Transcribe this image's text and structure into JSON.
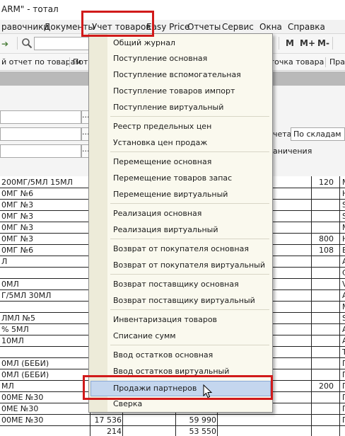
{
  "window": {
    "title": "ARM\" - тотал"
  },
  "menubar": {
    "items": [
      {
        "label": "равочники"
      },
      {
        "label": "Документы"
      },
      {
        "label": "Учет товаров"
      },
      {
        "label": "Easy Price"
      },
      {
        "label": "Отчеты"
      },
      {
        "label": "Сервис"
      },
      {
        "label": "Окна"
      },
      {
        "label": "Справка"
      }
    ]
  },
  "toolbar": {
    "m": "M",
    "m_plus": "M+",
    "m_minus": "M-"
  },
  "links": {
    "items": [
      {
        "label": "й отчет по товарам"
      },
      {
        "label": "Потр"
      },
      {
        "label": "оточка товара"
      },
      {
        "label": "Пра"
      }
    ]
  },
  "form": {
    "dots": "...",
    "report_label": "чета:",
    "report_value": "По складам",
    "restrict_label": "аничения"
  },
  "dropdown": {
    "items": [
      {
        "label": "Общий журнал"
      },
      {
        "label": "Поступление основная"
      },
      {
        "label": "Поступление вспомогательная"
      },
      {
        "label": "Поступление товаров импорт"
      },
      {
        "label": "Поступление виртуальный"
      },
      {
        "label": "Реестр предельных цен"
      },
      {
        "label": "Установка цен продаж"
      },
      {
        "label": "Перемещение основная"
      },
      {
        "label": "Перемещение товаров запас"
      },
      {
        "label": "Перемещение виртуальный"
      },
      {
        "label": "Реализация основная"
      },
      {
        "label": "Реализация виртуальный"
      },
      {
        "label": "Возврат от покупателя основная"
      },
      {
        "label": "Возврат от покупателя виртуальный"
      },
      {
        "label": "Возврат поставщику основная"
      },
      {
        "label": "Возврат поставщику виртуальный"
      },
      {
        "label": "Инвентаризация товаров"
      },
      {
        "label": "Списание сумм"
      },
      {
        "label": "Ввод остатков основная"
      },
      {
        "label": "Ввод остатков виртуальный"
      },
      {
        "label": "Продажи партнеров"
      },
      {
        "label": "Сверка"
      }
    ],
    "highlighted": "Продажи партнеров"
  },
  "grid": {
    "rows": [
      {
        "name": "200МГ/5МЛ 15МЛ",
        "c1": "",
        "c2": "",
        "qty": "120",
        "tail": "М"
      },
      {
        "name": "0МГ №6",
        "c1": "",
        "c2": "",
        "qty": "",
        "tail": "Н"
      },
      {
        "name": "0МГ №3",
        "c1": "",
        "c2": "",
        "qty": "",
        "tail": "S"
      },
      {
        "name": "0МГ №3",
        "c1": "",
        "c2": "",
        "qty": "",
        "tail": "S"
      },
      {
        "name": "0МГ №3",
        "c1": "",
        "c2": "",
        "qty": "",
        "tail": "М"
      },
      {
        "name": "0МГ №3",
        "c1": "",
        "c2": "",
        "qty": "800",
        "tail": "Н"
      },
      {
        "name": "0МГ №6",
        "c1": "",
        "c2": "",
        "qty": "108",
        "tail": "Е"
      },
      {
        "name": "Л",
        "c1": "",
        "c2": "",
        "qty": "",
        "tail": "А"
      },
      {
        "name": "",
        "c1": "",
        "c2": "",
        "qty": "",
        "tail": "С"
      },
      {
        "name": "0МЛ",
        "c1": "",
        "c2": "",
        "qty": "",
        "tail": "V"
      },
      {
        "name": "Г/5МЛ 30МЛ",
        "c1": "",
        "c2": "",
        "qty": "",
        "tail": "А"
      },
      {
        "name": "",
        "c1": "",
        "c2": "",
        "qty": "",
        "tail": "М"
      },
      {
        "name": "ЛМЛ №5",
        "c1": "",
        "c2": "",
        "qty": "",
        "tail": "S"
      },
      {
        "name": "% 5МЛ",
        "c1": "",
        "c2": "",
        "qty": "",
        "tail": "А"
      },
      {
        "name": "10МЛ",
        "c1": "",
        "c2": "",
        "qty": "",
        "tail": "А"
      },
      {
        "name": "",
        "c1": "",
        "c2": "",
        "qty": "",
        "tail": "Т"
      },
      {
        "name": "0МЛ (БЕБИ)",
        "c1": "",
        "c2": "",
        "qty": "",
        "tail": "Г"
      },
      {
        "name": "0МЛ (БЕБИ)",
        "c1": "",
        "c2": "",
        "qty": "",
        "tail": "Г"
      },
      {
        "name": "МЛ",
        "c1": "",
        "c2": "",
        "qty": "200",
        "tail": "П"
      },
      {
        "name": "00МЕ №30",
        "c1": "",
        "c2": "",
        "qty": "",
        "tail": "Г"
      },
      {
        "name": "0МЕ №30",
        "c1": "",
        "c2": "",
        "qty": "",
        "tail": "Г"
      },
      {
        "name": "00МЕ №30",
        "c1": "17 536",
        "c2": "59 990",
        "qty": "",
        "tail": "Г"
      },
      {
        "name": "",
        "c1": "214",
        "c2": "53 550",
        "qty": "",
        "tail": ""
      }
    ]
  }
}
